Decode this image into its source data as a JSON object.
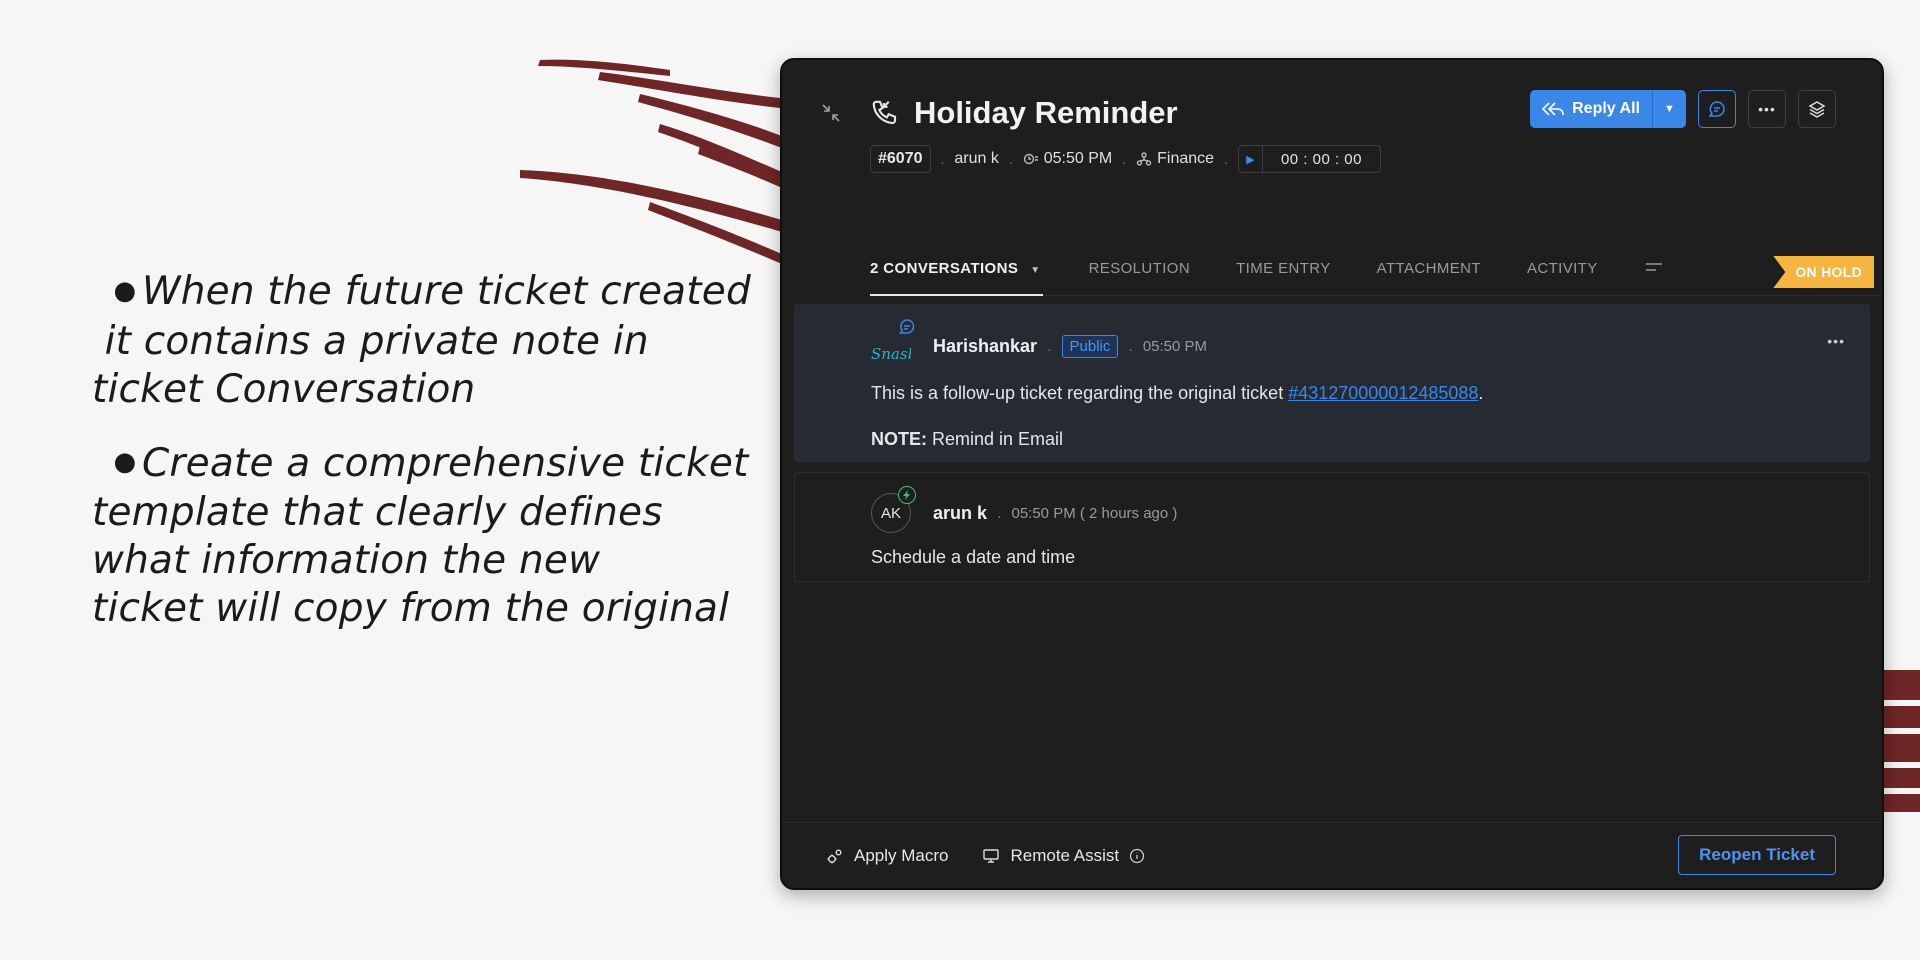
{
  "notes": [
    {
      "line1": "When the future ticket created",
      "line2": " it contains a private note in",
      "line3": "ticket Conversation"
    },
    {
      "line1": "Create a comprehensive ticket",
      "line2": "template that clearly defines",
      "line3": "what information the new",
      "line4": "ticket will copy from the original"
    }
  ],
  "ticket": {
    "title": "Holiday Reminder",
    "type_icon": "phone-icon",
    "id": "#6070",
    "requester": "arun k",
    "due_time": "05:50 PM",
    "department": "Finance",
    "timer": "00 : 00 : 00",
    "status": "ON HOLD"
  },
  "actions": {
    "reply_label": "Reply All"
  },
  "tabs": [
    {
      "label": "2 CONVERSATIONS",
      "active": true
    },
    {
      "label": "RESOLUTION"
    },
    {
      "label": "TIME ENTRY"
    },
    {
      "label": "ATTACHMENT"
    },
    {
      "label": "ACTIVITY"
    }
  ],
  "conversations": [
    {
      "author": "Harishankar",
      "visibility": "Public",
      "time": "05:50 PM",
      "text_prefix": "This is a follow-up ticket regarding the original ticket ",
      "link_text": "#431270000012485088",
      "text_suffix": ".",
      "note_label": "NOTE:",
      "note_text": " Remind in Email",
      "avatar_text": "Snasbu"
    },
    {
      "author": "arun k",
      "time": "05:50 PM ( 2 hours ago )",
      "initials": "AK",
      "text": "Schedule a date and time"
    }
  ],
  "footer": {
    "macro_label": "Apply Macro",
    "remote_label": "Remote Assist",
    "reopen_label": "Reopen Ticket"
  },
  "colors": {
    "accent": "#3a87e8",
    "status_on_hold": "#f5b53f",
    "window_bg": "#1e1e1f",
    "brush": "#6e2626"
  }
}
